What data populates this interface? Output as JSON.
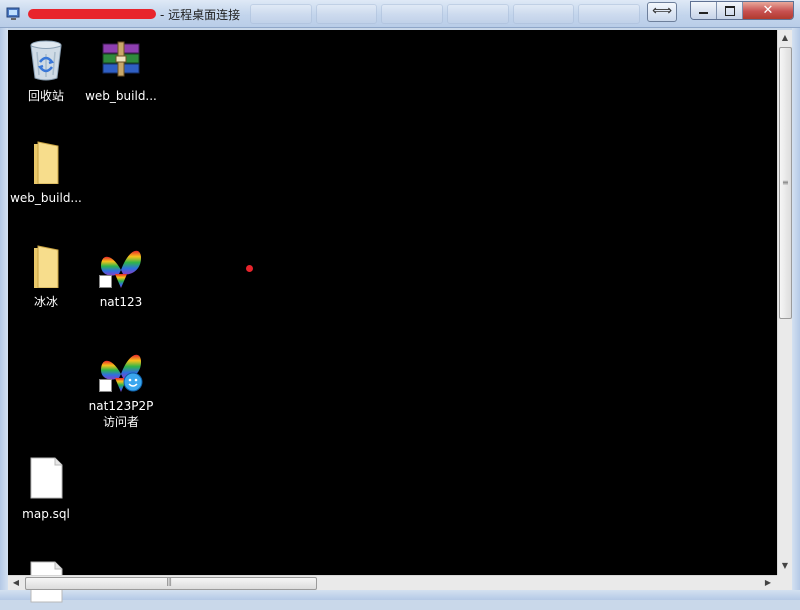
{
  "window": {
    "title": "- 远程桌面连接",
    "restore_glyph": "⟺",
    "close_glyph": "✕"
  },
  "desktop_icons": [
    {
      "label": "回收站",
      "icon": "recycle-bin-icon"
    },
    {
      "label": "web_build...",
      "icon": "winrar-archive-icon"
    },
    {
      "label": "web_build...",
      "icon": "folder-icon"
    },
    {
      "label": "冰冰",
      "icon": "folder-icon"
    },
    {
      "label": "nat123",
      "icon": "nat123-butterfly-icon"
    },
    {
      "label": "nat123P2P访问者",
      "icon": "nat123-p2p-butterfly-icon"
    },
    {
      "label": "map.sql",
      "icon": "document-icon"
    },
    {
      "label": "",
      "icon": "document-icon"
    }
  ],
  "colors": {
    "desktop_background": "#000000",
    "redaction": "#e8242c",
    "close_button": "#c75050"
  }
}
